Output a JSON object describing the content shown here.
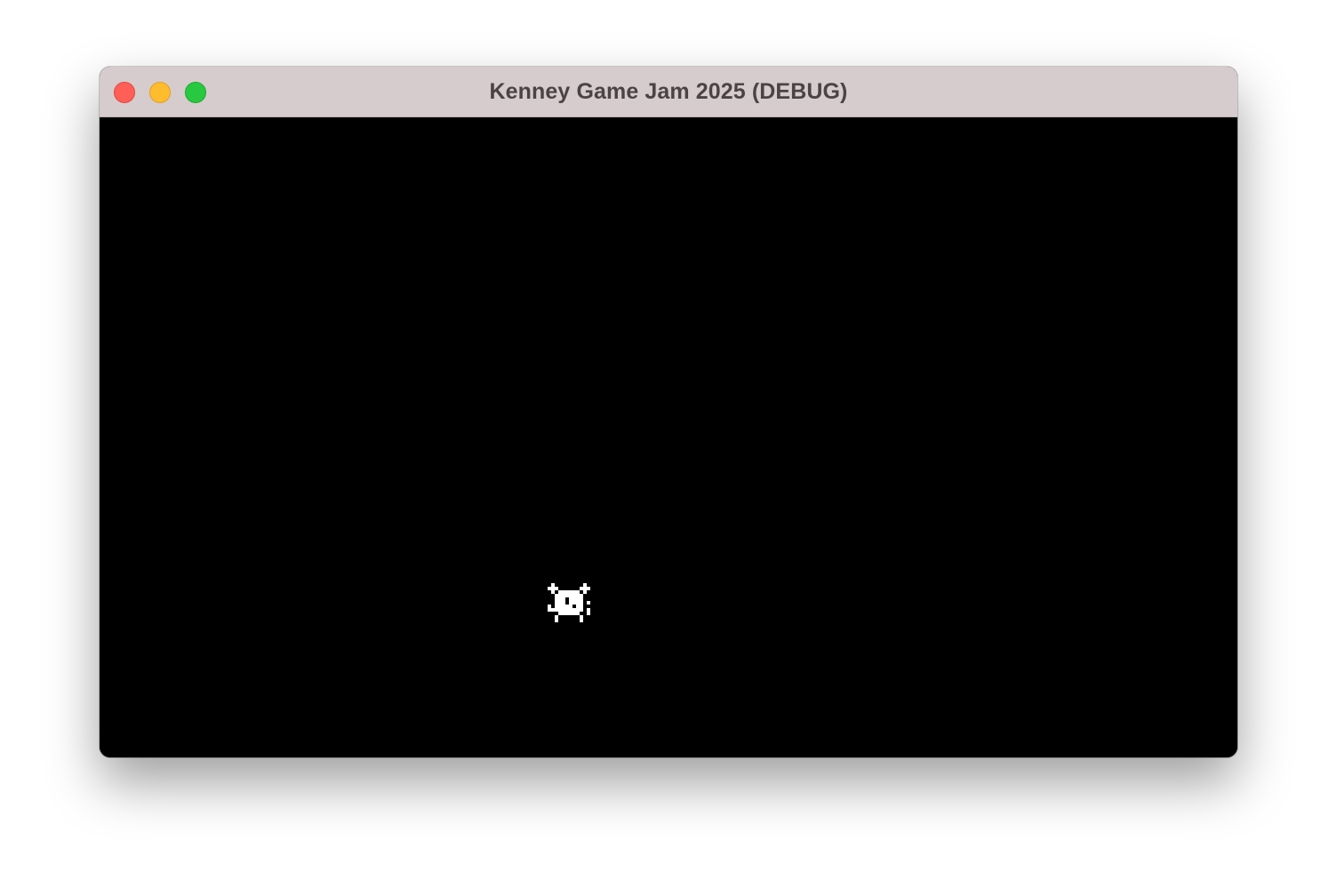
{
  "window": {
    "title": "Kenney Game Jam 2025 (DEBUG)",
    "titlebar_color": "#d6cccd",
    "buttons": [
      {
        "name": "close",
        "color": "#ff5f57",
        "border": "#e2463f"
      },
      {
        "name": "minimize",
        "color": "#febc2e",
        "border": "#dea123"
      },
      {
        "name": "zoom",
        "color": "#28c840",
        "border": "#1aab29"
      }
    ]
  },
  "game": {
    "background": "#000000",
    "player_sprite": {
      "icon": "pixel-creature-icon",
      "color": "#ffffff"
    }
  }
}
